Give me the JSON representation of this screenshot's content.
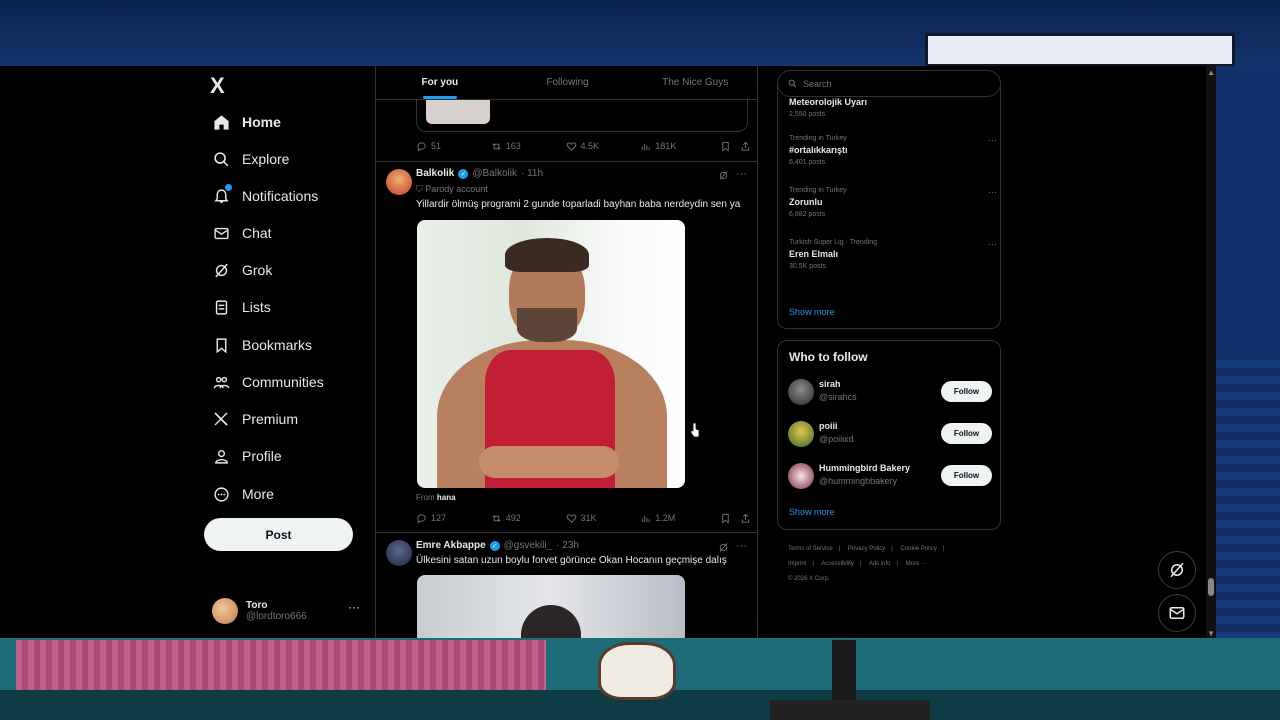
{
  "nav": {
    "logo": "X",
    "items": [
      {
        "label": "Home",
        "icon": "home-icon"
      },
      {
        "label": "Explore",
        "icon": "search-icon"
      },
      {
        "label": "Notifications",
        "icon": "bell-icon"
      },
      {
        "label": "Chat",
        "icon": "mail-icon"
      },
      {
        "label": "Grok",
        "icon": "grok-icon"
      },
      {
        "label": "Lists",
        "icon": "list-icon"
      },
      {
        "label": "Bookmarks",
        "icon": "bookmark-icon"
      },
      {
        "label": "Communities",
        "icon": "people-icon"
      },
      {
        "label": "Premium",
        "icon": "x-icon"
      },
      {
        "label": "Profile",
        "icon": "person-icon"
      },
      {
        "label": "More",
        "icon": "more-circle-icon"
      }
    ],
    "post_label": "Post",
    "account": {
      "name": "Toro",
      "handle": "@lordtoro666",
      "more": "···"
    }
  },
  "tabs": [
    "For you",
    "Following",
    "The Nice Guys"
  ],
  "tweets": [
    {
      "actions": {
        "replies": "51",
        "reposts": "163",
        "likes": "4.5K",
        "views": "181K"
      }
    },
    {
      "name": "Balkolik",
      "handle": "@Balkolik",
      "time": "· 11h",
      "badge": "Parody account",
      "text": "Yillardir ölmüş programi 2 gunde toparladi bayhan baba nerdeydin sen ya",
      "from_prefix": "From",
      "from_name": "hana",
      "actions": {
        "replies": "127",
        "reposts": "492",
        "likes": "31K",
        "views": "1.2M"
      }
    },
    {
      "name": "Emre Akbappe",
      "handle": "@gsvekili_",
      "time": "· 23h",
      "text": "Ülkesini satan uzun boylu forvet görünce Okan Hocanın geçmişe dalış"
    }
  ],
  "search": {
    "placeholder": "Search"
  },
  "trends": [
    {
      "context": "Trending in Turkey",
      "name": "Meteorolojik Uyarı",
      "posts": "2,550 posts"
    },
    {
      "context": "Trending in Turkey",
      "name": "#ortalıkkarıştı",
      "posts": "6,401 posts"
    },
    {
      "context": "Trending in Turkey",
      "name": "Zorunlu",
      "posts": "6,882 posts"
    },
    {
      "context": "Turkish Super Lig · Trending",
      "name": "Eren Elmalı",
      "posts": "30.5K posts"
    }
  ],
  "show_more": "Show more",
  "who_to_follow": {
    "title": "Who to follow",
    "follow_label": "Follow",
    "users": [
      {
        "name": "sirah",
        "handle": "@sirahcs"
      },
      {
        "name": "poiii",
        "handle": "@poiiixd"
      },
      {
        "name": "Hummingbird Bakery",
        "handle": "@hummingbbakery"
      }
    ]
  },
  "footer": [
    "Terms of Service",
    "|",
    "Privacy Policy",
    "|",
    "Cookie Policy",
    "|",
    "Imprint",
    "|",
    "Accessibility",
    "|",
    "Ads info",
    "|",
    "More ···",
    "© 2026 X Corp."
  ],
  "colors": {
    "accent": "#1d9bf0",
    "background": "#000000",
    "border": "#2f3336",
    "muted": "#71767b"
  }
}
